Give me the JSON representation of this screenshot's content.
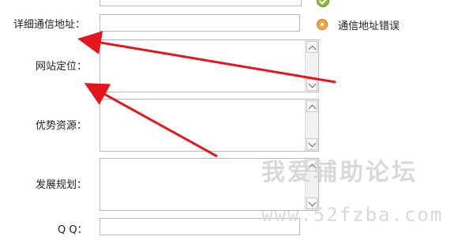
{
  "form": {
    "address_label": "详细通信地址：",
    "website_label": "网站定位：",
    "advantage_label": "优势资源：",
    "plan_label": "发展规划：",
    "qq_label": "Q Q："
  },
  "validation": {
    "address_error": "通信地址错误"
  },
  "watermark": {
    "title": "我爱辅助论坛",
    "url": "www.52fzba.com"
  },
  "colors": {
    "arrow_red": "#e5151d",
    "error_orange": "#f5a640",
    "ok_green": "#8dbb3a",
    "watermark_gray": "#d9d9d9"
  }
}
